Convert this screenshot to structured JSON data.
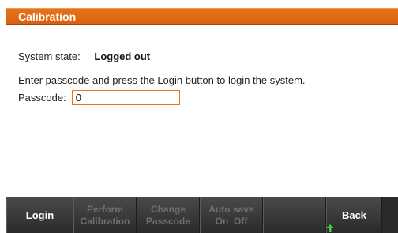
{
  "window": {
    "title": "Calibration"
  },
  "content": {
    "system_state_label": "System state:",
    "system_state_value": "Logged out",
    "instructions": "Enter passcode and press the Login button to login the system.",
    "passcode_label": "Passcode:",
    "passcode_value": "0"
  },
  "softkeys": {
    "login": "Login",
    "perform_calibration_line1": "Perform",
    "perform_calibration_line2": "Calibration",
    "change_passcode_line1": "Change",
    "change_passcode_line2": "Passcode",
    "auto_save_line1": "Auto save",
    "auto_save_line2": "On  Off",
    "empty": "",
    "back": "Back"
  },
  "colors": {
    "title_bar": "#e06812",
    "input_border": "#e9731c",
    "softkey_enabled_text": "#ffffff",
    "softkey_disabled_text": "#6e6e6e",
    "back_arrow": "#3fcf3f"
  },
  "icons": {
    "back_indicator": "up-arrow-icon"
  }
}
